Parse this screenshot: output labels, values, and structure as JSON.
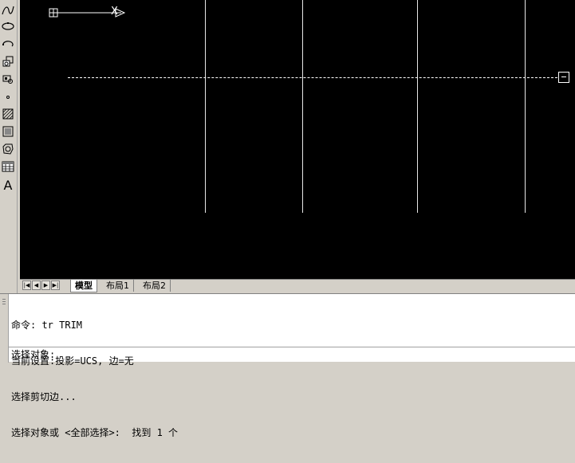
{
  "toolbar": {
    "tools": [
      {
        "icon": "spline-icon"
      },
      {
        "icon": "ellipse-icon"
      },
      {
        "icon": "ellipse-arc-icon"
      },
      {
        "icon": "insert-block-icon"
      },
      {
        "icon": "make-block-icon"
      },
      {
        "icon": "point-icon"
      },
      {
        "icon": "hatch-icon"
      },
      {
        "icon": "gradient-icon"
      },
      {
        "icon": "region-icon"
      },
      {
        "icon": "table-icon"
      },
      {
        "icon": "multiline-text-icon",
        "glyph": "A"
      }
    ]
  },
  "canvas": {
    "background": "#000000",
    "ucs_axis_label": "X"
  },
  "layout_tabs": {
    "tabs": [
      {
        "label": "模型",
        "active": true
      },
      {
        "label": "布局1",
        "active": false
      },
      {
        "label": "布局2",
        "active": false
      }
    ]
  },
  "command": {
    "history": [
      "命令: tr TRIM",
      "当前设置:投影=UCS, 边=无",
      "选择剪切边...",
      "选择对象或 <全部选择>:  找到 1 个"
    ],
    "prompt": "选择对象:"
  }
}
